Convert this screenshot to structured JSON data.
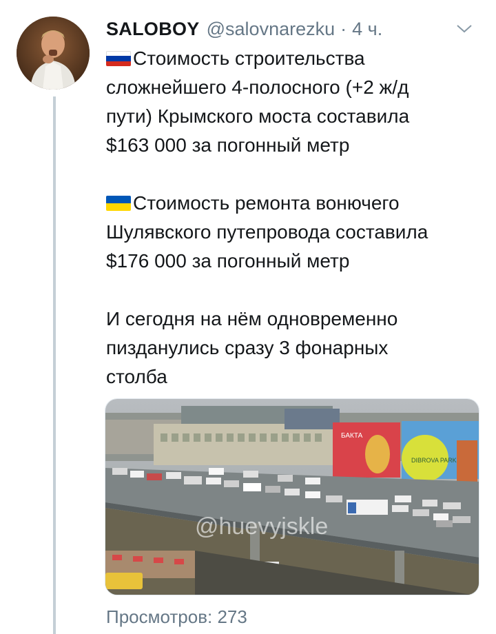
{
  "tweet": {
    "author_name": "SALOBOY",
    "author_handle": "@salovnarezku",
    "separator": "·",
    "timestamp": "4 ч.",
    "avatar_icon": "user-avatar-photo",
    "caret_icon": "chevron-down-icon",
    "paragraphs": [
      {
        "flag": "russia-flag-icon",
        "lines": [
          "Стоимость строительства",
          "сложнейшего 4-полосного (+2 ж/д",
          "пути) Крымского моста составила",
          "$163 000 за погонный метр"
        ]
      },
      {
        "flag": "ukraine-flag-icon",
        "lines": [
          "Стоимость ремонта вонючего",
          "Шулявского путепровода составила",
          "$176 000 за погонный метр"
        ]
      },
      {
        "lines": [
          "И сегодня на нём одновременно",
          "пизданулись сразу 3 фонарных",
          "столба"
        ]
      }
    ],
    "media": {
      "watermark": "@huevyjskle",
      "billboard_text": "DIBROVA PARK",
      "billboard_text_red": "БАКТА"
    },
    "views": "Просмотров: 273"
  },
  "colors": {
    "text": "#14171a",
    "secondary": "#657786",
    "thread_line": "#c4cfd6",
    "russia_flag": [
      "#ffffff",
      "#0039a6",
      "#d52b1e"
    ],
    "ukraine_flag": [
      "#0057b7",
      "#ffd700"
    ]
  }
}
